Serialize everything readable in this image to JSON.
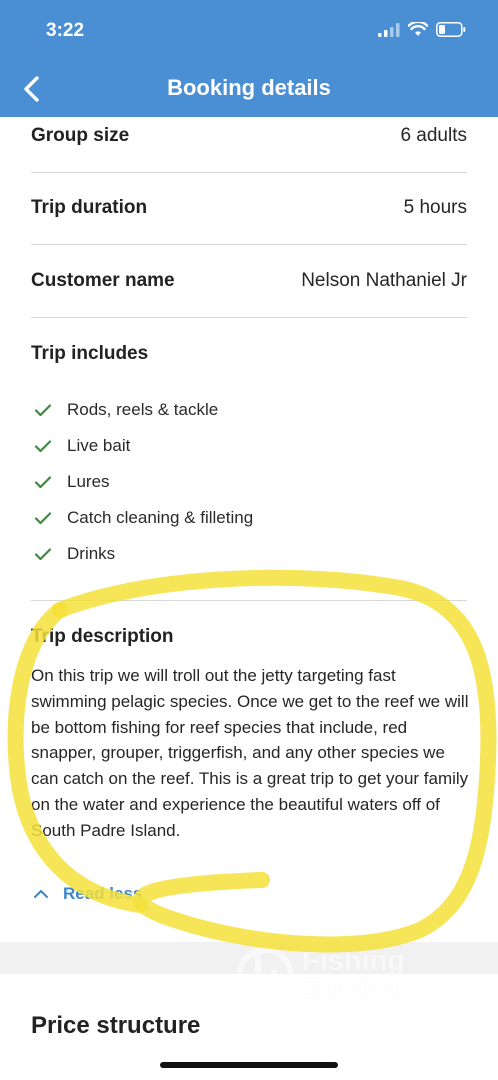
{
  "status_bar": {
    "time": "3:22"
  },
  "header": {
    "title": "Booking details"
  },
  "details": [
    {
      "label": "Group size",
      "value": "6 adults"
    },
    {
      "label": "Trip duration",
      "value": "5 hours"
    },
    {
      "label": "Customer name",
      "value": "Nelson Nathaniel Jr"
    }
  ],
  "includes": {
    "title": "Trip includes",
    "items": [
      "Rods, reels & tackle",
      "Live bait",
      "Lures",
      "Catch cleaning & filleting",
      "Drinks"
    ]
  },
  "description": {
    "title": "Trip description",
    "text": "On this trip we will troll out the jetty targeting fast swimming pelagic species. Once we get to the reef we will be bottom fishing for reef species that include, red snapper, grouper, triggerfish, and any other species we can catch on the reef. This is a great trip to get your family on the water and experience the beautiful waters off of South Padre Island.",
    "toggle_label": "Read less"
  },
  "watermark": {
    "line1": "Fishing",
    "line2": "Booker"
  },
  "price": {
    "title": "Price structure"
  },
  "colors": {
    "accent": "#4a8ed3",
    "check": "#3b8a3e",
    "highlight": "#f5e13a"
  }
}
